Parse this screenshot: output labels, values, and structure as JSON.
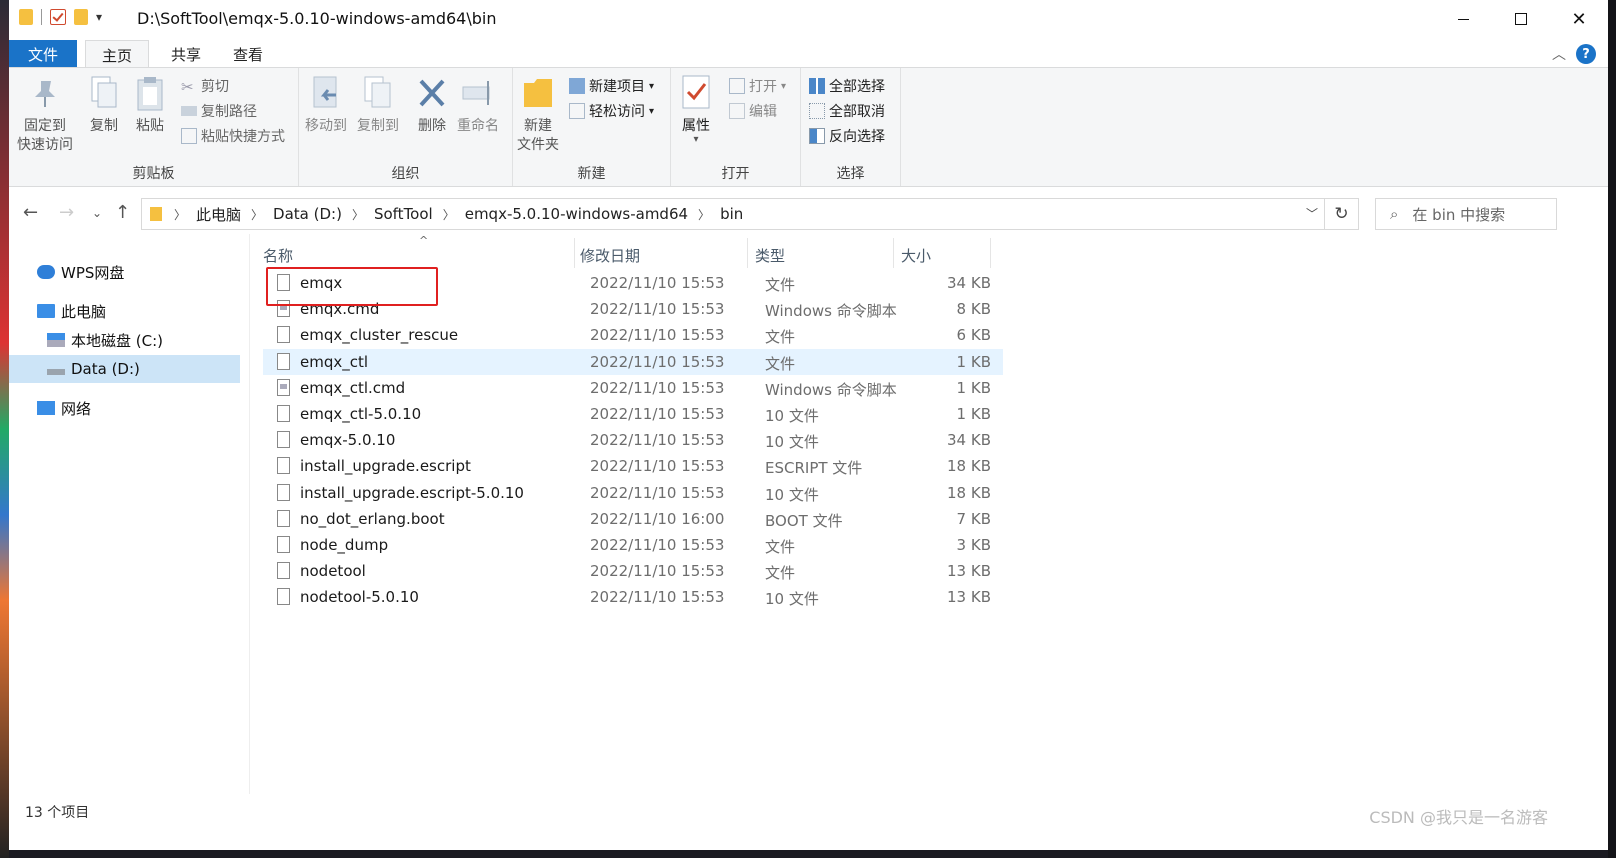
{
  "window": {
    "path": "D:\\SoftTool\\emqx-5.0.10-windows-amd64\\bin",
    "close_glyph": "✕"
  },
  "tabs": {
    "file": "文件",
    "home": "主页",
    "share": "共享",
    "view": "查看"
  },
  "ribbon": {
    "clipboard": {
      "label": "剪贴板",
      "pin": "固定到\n快速访问",
      "pin_line1": "固定到",
      "pin_line2": "快速访问",
      "copy": "复制",
      "paste": "粘贴",
      "cut": "剪切",
      "copy_path": "复制路径",
      "paste_shortcut": "粘贴快捷方式"
    },
    "organize": {
      "label": "组织",
      "move_to": "移动到",
      "copy_to": "复制到",
      "delete": "删除",
      "rename": "重命名"
    },
    "new": {
      "label": "新建",
      "new_folder_1": "新建",
      "new_folder_2": "文件夹",
      "new_item": "新建项目",
      "easy_access": "轻松访问"
    },
    "open": {
      "label": "打开",
      "properties": "属性",
      "open": "打开",
      "edit": "编辑"
    },
    "select": {
      "label": "选择",
      "select_all": "全部选择",
      "select_none": "全部取消",
      "invert": "反向选择"
    }
  },
  "breadcrumb": [
    "此电脑",
    "Data (D:)",
    "SoftTool",
    "emqx-5.0.10-windows-amd64",
    "bin"
  ],
  "search": {
    "placeholder": "在 bin 中搜索"
  },
  "nav": {
    "wps": "WPS网盘",
    "this_pc": "此电脑",
    "drive_c": "本地磁盘 (C:)",
    "drive_d": "Data (D:)",
    "network": "网络"
  },
  "columns": {
    "name": "名称",
    "modified": "修改日期",
    "type": "类型",
    "size": "大小"
  },
  "files": [
    {
      "name": "emqx",
      "modified": "2022/11/10 15:53",
      "type": "文件",
      "size": "34 KB",
      "icon": "file-icon"
    },
    {
      "name": "emqx.cmd",
      "modified": "2022/11/10 15:53",
      "type": "Windows 命令脚本",
      "size": "8 KB",
      "icon": "cmd-script-icon"
    },
    {
      "name": "emqx_cluster_rescue",
      "modified": "2022/11/10 15:53",
      "type": "文件",
      "size": "6 KB",
      "icon": "file-icon"
    },
    {
      "name": "emqx_ctl",
      "modified": "2022/11/10 15:53",
      "type": "文件",
      "size": "1 KB",
      "icon": "file-icon"
    },
    {
      "name": "emqx_ctl.cmd",
      "modified": "2022/11/10 15:53",
      "type": "Windows 命令脚本",
      "size": "1 KB",
      "icon": "cmd-script-icon"
    },
    {
      "name": "emqx_ctl-5.0.10",
      "modified": "2022/11/10 15:53",
      "type": "10 文件",
      "size": "1 KB",
      "icon": "file-icon"
    },
    {
      "name": "emqx-5.0.10",
      "modified": "2022/11/10 15:53",
      "type": "10 文件",
      "size": "34 KB",
      "icon": "file-icon"
    },
    {
      "name": "install_upgrade.escript",
      "modified": "2022/11/10 15:53",
      "type": "ESCRIPT 文件",
      "size": "18 KB",
      "icon": "file-icon"
    },
    {
      "name": "install_upgrade.escript-5.0.10",
      "modified": "2022/11/10 15:53",
      "type": "10 文件",
      "size": "18 KB",
      "icon": "file-icon"
    },
    {
      "name": "no_dot_erlang.boot",
      "modified": "2022/11/10 16:00",
      "type": "BOOT 文件",
      "size": "7 KB",
      "icon": "file-icon"
    },
    {
      "name": "node_dump",
      "modified": "2022/11/10 15:53",
      "type": "文件",
      "size": "3 KB",
      "icon": "file-icon"
    },
    {
      "name": "nodetool",
      "modified": "2022/11/10 15:53",
      "type": "文件",
      "size": "13 KB",
      "icon": "file-icon"
    },
    {
      "name": "nodetool-5.0.10",
      "modified": "2022/11/10 15:53",
      "type": "10 文件",
      "size": "13 KB",
      "icon": "file-icon"
    }
  ],
  "status": {
    "count": "13 个项目"
  },
  "watermark": "CSDN @我只是一名游客",
  "colors": {
    "accent": "#1a73c8",
    "selection": "#cce4f7",
    "highlight": "#e5f3ff",
    "annotation": "#e02020"
  }
}
